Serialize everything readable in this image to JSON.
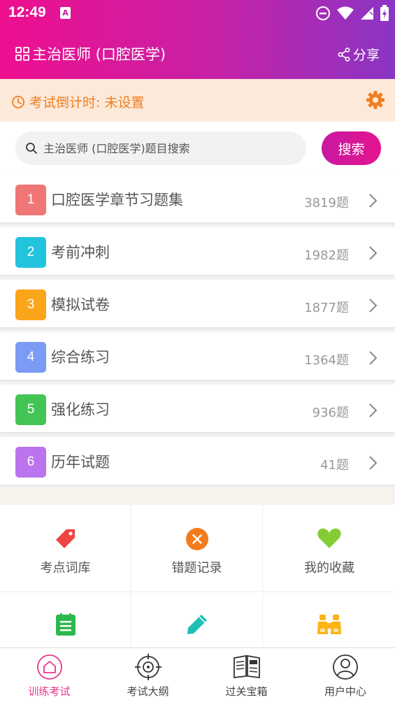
{
  "status_bar": {
    "time": "12:49",
    "app_badge": "A"
  },
  "header": {
    "title": "主治医师 (口腔医学)",
    "share_label": "分享"
  },
  "countdown": {
    "text": "考试倒计时: 未设置"
  },
  "search": {
    "placeholder": "主治医师 (口腔医学)题目搜索",
    "button_label": "搜索"
  },
  "list": [
    {
      "num": "1",
      "label": "口腔医学章节习题集",
      "count": "3819题",
      "color": "#f07676"
    },
    {
      "num": "2",
      "label": "考前冲刺",
      "count": "1982题",
      "color": "#22c3dc"
    },
    {
      "num": "3",
      "label": "模拟试卷",
      "count": "1877题",
      "color": "#fba51a"
    },
    {
      "num": "4",
      "label": "综合练习",
      "count": "1364题",
      "color": "#7c9bf6"
    },
    {
      "num": "5",
      "label": "强化练习",
      "count": "936题",
      "color": "#43c556"
    },
    {
      "num": "6",
      "label": "历年试题",
      "count": "41题",
      "color": "#bb74ee"
    }
  ],
  "grid": [
    {
      "label": "考点词库",
      "icon": "tag-icon",
      "color": "#ee4444"
    },
    {
      "label": "错题记录",
      "icon": "close-circle-icon",
      "color": "#f47c1c"
    },
    {
      "label": "我的收藏",
      "icon": "heart-icon",
      "color": "#84cc36"
    },
    {
      "label": "",
      "icon": "notes-icon",
      "color": "#2db84d"
    },
    {
      "label": "",
      "icon": "pencil-icon",
      "color": "#1ebfb5"
    },
    {
      "label": "",
      "icon": "binoculars-icon",
      "color": "#fbb416"
    }
  ],
  "tabs": [
    {
      "label": "训练考试",
      "icon": "home-icon",
      "active": true
    },
    {
      "label": "考试大纲",
      "icon": "target-icon",
      "active": false
    },
    {
      "label": "过关宝箱",
      "icon": "newspaper-icon",
      "active": false
    },
    {
      "label": "用户中心",
      "icon": "user-icon",
      "active": false
    }
  ],
  "colors": {
    "accent": "#e5148f",
    "countdown_text": "#f07d1e",
    "countdown_bg": "#fde9d9"
  }
}
